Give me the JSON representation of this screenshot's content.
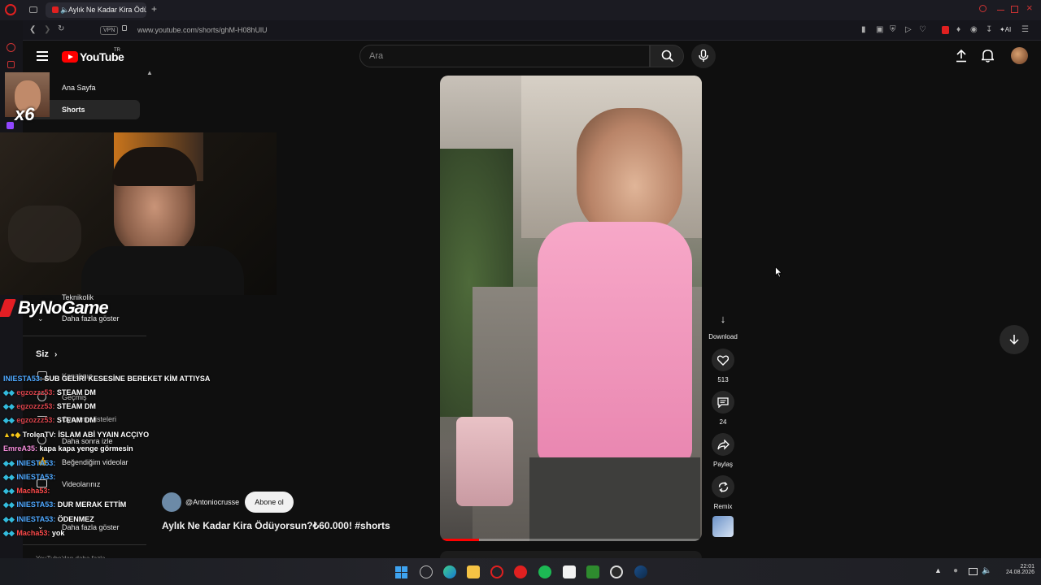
{
  "browser": {
    "tab_title": "Aylık Ne Kadar Kira Ödü",
    "url": "www.youtube.com/shorts/ghM-H08hUlU",
    "vpn_label": "VPN",
    "ai_label": "AI",
    "new_tab_label": "+"
  },
  "header": {
    "logo_text": "YouTube",
    "logo_country": "TR",
    "search_placeholder": "Ara"
  },
  "sidebar": {
    "items": [
      {
        "label": "Ana Sayfa"
      },
      {
        "label": "Shorts"
      }
    ],
    "subscription_partial": "Teknikolik",
    "more_1": "Daha fazla göster",
    "you_section": "Siz",
    "you_items": [
      {
        "label": "Kanalınız"
      },
      {
        "label": "Geçmiş"
      },
      {
        "label": "Oynatma listeleri"
      },
      {
        "label": "Daha sonra izle"
      },
      {
        "label": "Beğendiğim videolar"
      },
      {
        "label": "Videolarınız"
      }
    ],
    "more_2": "Daha fazla göster",
    "bottom_partial": "YouTube'dan daha fazla"
  },
  "overlay": {
    "emote_multiplier": "x6",
    "brand": "ByNoGame",
    "chat": [
      {
        "user": "INIESTA53:",
        "msg": "SUB GELİRİ KESESİNE BEREKET KİM ATTIYSA",
        "color": "#4ea8ff"
      },
      {
        "user": "egzozzz53:",
        "msg": "STEAM DM",
        "color": "#d9434b"
      },
      {
        "user": "egzozzz53:",
        "msg": "STEAM DM",
        "color": "#d9434b"
      },
      {
        "user": "egzozzz53:",
        "msg": "STEAM DM",
        "color": "#d9434b"
      },
      {
        "user": "TrolenTV:",
        "msg": "İSLAM ABİ YYAIN ACÇIYO",
        "color": "#f2f2f2"
      },
      {
        "user": "EmreA35:",
        "msg": "kapa kapa yenge görmesin",
        "color": "#f28bd8"
      },
      {
        "user": "INIESTA53:",
        "msg": "",
        "color": "#4ea8ff"
      },
      {
        "user": "INIESTA53:",
        "msg": "",
        "color": "#4ea8ff"
      },
      {
        "user": "Macha53:",
        "msg": "",
        "color": "#ff4b4b"
      },
      {
        "user": "INIESTA53:",
        "msg": "DUR MERAK ETTİM",
        "color": "#4ea8ff"
      },
      {
        "user": "INIESTA53:",
        "msg": "ÖDENMEZ",
        "color": "#4ea8ff"
      },
      {
        "user": "Macha53:",
        "msg": "yok",
        "color": "#ff4b4b"
      }
    ]
  },
  "short": {
    "channel": "@Antoniocrusse",
    "subscribe_label": "Abone ol",
    "title": "Aylık Ne Kadar Kira Ödüyorsun?₺60.000! #shorts",
    "progress": 0.15,
    "actions": {
      "download": "Download",
      "likes": "513",
      "comments": "24",
      "share": "Paylaş",
      "remix": "Remix"
    }
  },
  "taskbar": {
    "time": "22:01",
    "date": "24.08.2026"
  },
  "colors": {
    "yt_red": "#ff0000",
    "background": "#0f0f0f",
    "opera_red": "#e02020"
  }
}
